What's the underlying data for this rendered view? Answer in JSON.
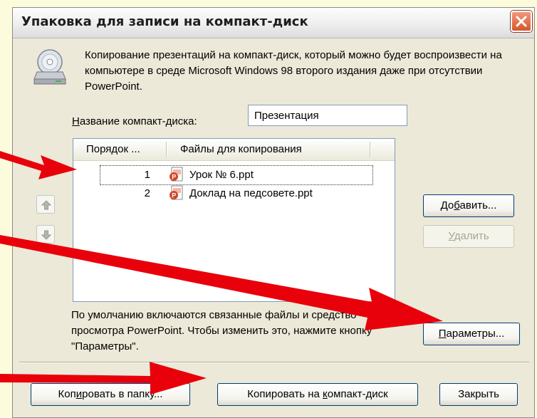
{
  "dialog": {
    "title": "Упаковка для записи на компакт-диск",
    "description": "Копирование презентаций на компакт-диск, который можно будет воспроизвести на компьютере в среде Microsoft Windows 98 второго издания даже при отсутствии PowerPoint.",
    "cd_name": {
      "label_hotkey": "Н",
      "label_rest": "азвание компакт-диска:",
      "value": "Презентация"
    },
    "list": {
      "columns": [
        "Порядок ...",
        "Файлы для копирования"
      ],
      "rows": [
        {
          "order": "1",
          "file": "Урок № 6.ppt",
          "selected": true
        },
        {
          "order": "2",
          "file": "Доклад на педсовете.ppt",
          "selected": false
        }
      ]
    },
    "buttons": {
      "add": {
        "pre": "До",
        "key": "б",
        "post": "авить..."
      },
      "remove": {
        "pre": "",
        "key": "У",
        "post": "далить"
      },
      "options": {
        "pre": "",
        "key": "П",
        "post": "араметры..."
      },
      "copy_folder": {
        "pre": "Коп",
        "key": "и",
        "post": "ровать в папку..."
      },
      "copy_cd": {
        "pre": "Копировать на ",
        "key": "к",
        "post": "омпакт-диск"
      },
      "close": "Закрыть"
    },
    "note": "По умолчанию включаются связанные файлы и средство просмотра PowerPoint. Чтобы изменить это, нажмите кнопку \"Параметры\"."
  },
  "colors": {
    "slide_background": "#fcfbdc",
    "dialog_face": "#ece9d8",
    "annotation_arrows": "#e8000b",
    "close_button": "#d9552b"
  },
  "icons": [
    "cd-drive-icon",
    "close-icon",
    "move-up-icon",
    "move-down-icon",
    "ppt-file-icon"
  ]
}
